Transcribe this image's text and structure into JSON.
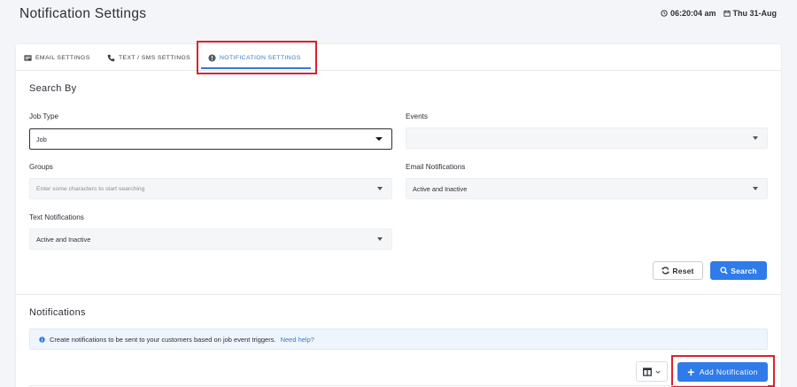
{
  "header": {
    "title": "Notification Settings",
    "time": "06:20:04 am",
    "date": "Thu 31-Aug"
  },
  "tabs": [
    {
      "label": "EMAIL SETTINGS",
      "icon": "email-settings-icon"
    },
    {
      "label": "TEXT / SMS SETTINGS",
      "icon": "phone-icon"
    },
    {
      "label": "NOTIFICATION SETTINGS",
      "icon": "alert-circle-icon",
      "active": true
    }
  ],
  "search": {
    "title": "Search By",
    "job_type": {
      "label": "Job Type",
      "value": "Job"
    },
    "events": {
      "label": "Events",
      "value": ""
    },
    "groups": {
      "label": "Groups",
      "placeholder": "Enter some characters to start searching"
    },
    "email_notifications": {
      "label": "Email Notifications",
      "value": "Active and Inactive"
    },
    "text_notifications": {
      "label": "Text Notifications",
      "value": "Active and Inactive"
    },
    "reset_label": "Reset",
    "search_label": "Search"
  },
  "notifications": {
    "title": "Notifications",
    "info_text": "Create notifications to be sent to your customers based on job event triggers.",
    "help_link": "Need help?",
    "add_label": "Add Notification"
  },
  "colors": {
    "accent": "#2f7be9",
    "tab_active": "#3a78c9",
    "highlight": "#d9232e"
  }
}
